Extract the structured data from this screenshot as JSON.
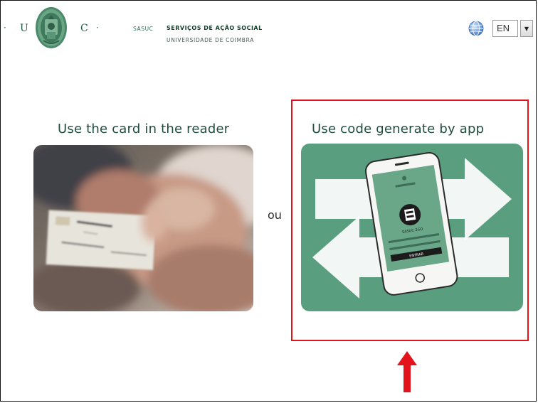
{
  "header": {
    "uc_left": "U",
    "uc_right": "C",
    "sasuc": "SASUC",
    "services_title": "SERVIÇOS DE AÇÃO SOCIAL",
    "university": "UNIVERSIDADE DE COIMBRA",
    "language": {
      "selected": "EN",
      "icon": "globe-icon"
    }
  },
  "options": {
    "card": {
      "title": "Use the card in the reader"
    },
    "separator": "ou",
    "app": {
      "title": "Use code generate by app",
      "phone_button": "ENTRAR",
      "phone_label": "SASUC 2GO"
    }
  },
  "colors": {
    "brand_green": "#5a9e80",
    "highlight_red": "#e3131c",
    "title_text": "#1f4d3d"
  }
}
